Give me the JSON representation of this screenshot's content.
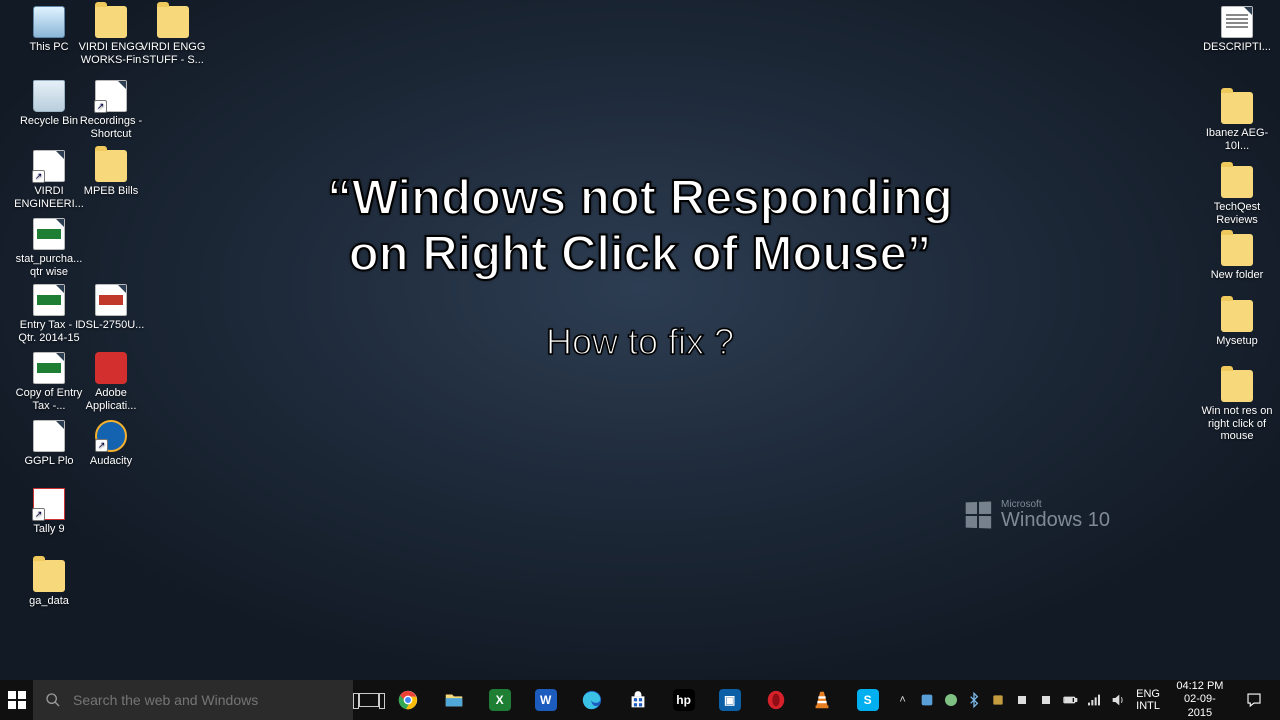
{
  "overlay": {
    "line1a": "“Windows not Responding",
    "line1b": "on Right Click of Mouse”",
    "line2": "How to fix ?"
  },
  "watermark": {
    "small": "Microsoft",
    "big": "Windows",
    "ver": "10"
  },
  "desktop_icons_left": [
    [
      {
        "name": "this-pc",
        "label": "This PC",
        "type": "pc"
      },
      {
        "name": "virdi-engg-works-fin",
        "label": "VIRDI ENGG WORKS-Fin",
        "type": "folder"
      },
      {
        "name": "virdi-engg-stuff-s",
        "label": "VIRDI ENGG STUFF - S...",
        "type": "folder"
      }
    ],
    [
      {
        "name": "recycle-bin",
        "label": "Recycle Bin",
        "type": "bin"
      },
      {
        "name": "recordings-shortcut",
        "label": "Recordings - Shortcut",
        "type": "file",
        "shortcut": true
      }
    ],
    [
      {
        "name": "virdi-engineering",
        "label": "VIRDI ENGINEERI...",
        "type": "file",
        "shortcut": true
      },
      {
        "name": "mpeb-bills",
        "label": "MPEB Bills",
        "type": "folder"
      }
    ],
    [
      {
        "name": "stat-purchase",
        "label": "stat_purcha... qtr wise",
        "type": "xls"
      }
    ],
    [
      {
        "name": "entry-tax",
        "label": "Entry Tax - I Qtr. 2014-15",
        "type": "xls"
      },
      {
        "name": "dsl-2750u",
        "label": "DSL-2750U...",
        "type": "pdf"
      }
    ],
    [
      {
        "name": "copy-entry-tax",
        "label": "Copy of Entry Tax -...",
        "type": "xls"
      },
      {
        "name": "adobe-application",
        "label": "Adobe Applicati...",
        "type": "adobe"
      }
    ],
    [
      {
        "name": "ggpl-plo",
        "label": "GGPL Plo",
        "type": "file"
      },
      {
        "name": "audacity",
        "label": "Audacity",
        "type": "audacity",
        "shortcut": true
      }
    ],
    [
      {
        "name": "tally-9",
        "label": "Tally 9",
        "type": "tally",
        "shortcut": true
      }
    ],
    [
      {
        "name": "ga-data",
        "label": "ga_data",
        "type": "folder"
      }
    ]
  ],
  "desktop_icons_right": [
    {
      "name": "description-txt",
      "label": "DESCRIPTI...",
      "type": "txt"
    },
    {
      "name": "ibanez-aeg-10i",
      "label": "Ibanez AEG-10I...",
      "type": "folder"
    },
    {
      "name": "techqest-reviews",
      "label": "TechQest Reviews",
      "type": "folder"
    },
    {
      "name": "new-folder",
      "label": "New folder",
      "type": "folder"
    },
    {
      "name": "mysetup",
      "label": "Mysetup",
      "type": "folder"
    },
    {
      "name": "win-not-res-folder",
      "label": "Win not res on right click of mouse",
      "type": "folder"
    }
  ],
  "taskbar": {
    "search_placeholder": "Search the web and Windows",
    "lang1": "ENG",
    "lang2": "INTL",
    "time": "04:12 PM",
    "date": "02-09-2015"
  },
  "taskbar_pins": [
    {
      "name": "chrome",
      "color": "",
      "type": "chrome"
    },
    {
      "name": "file-explorer",
      "type": "explorer"
    },
    {
      "name": "excel",
      "type": "sq",
      "bg": "#1e7e34",
      "txt": "X"
    },
    {
      "name": "word",
      "type": "sq",
      "bg": "#1b5cbe",
      "txt": "W"
    },
    {
      "name": "edge",
      "type": "edge"
    },
    {
      "name": "store",
      "type": "store"
    },
    {
      "name": "hp",
      "type": "sq",
      "bg": "#000",
      "txt": "hp"
    },
    {
      "name": "dropbox",
      "type": "sq",
      "bg": "#0a5fa6",
      "txt": "▣"
    },
    {
      "name": "opera",
      "type": "opera"
    },
    {
      "name": "vlc",
      "type": "vlc"
    },
    {
      "name": "skype",
      "type": "sq",
      "bg": "#00aff0",
      "txt": "S"
    }
  ]
}
